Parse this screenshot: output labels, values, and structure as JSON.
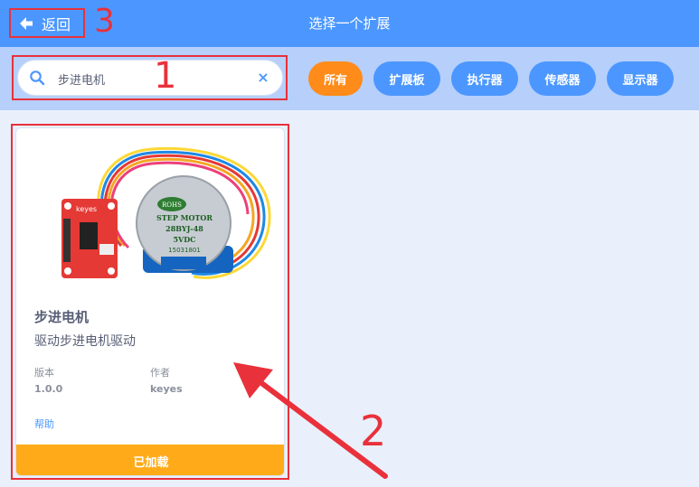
{
  "header": {
    "back_label": "返回",
    "title": "选择一个扩展",
    "back_icon": "arrow-left-icon"
  },
  "search": {
    "value": "步进电机",
    "search_icon": "search-icon",
    "clear_icon": "close-icon",
    "clear_symbol": "×"
  },
  "categories": [
    {
      "label": "所有",
      "active": true
    },
    {
      "label": "扩展板",
      "active": false
    },
    {
      "label": "执行器",
      "active": false
    },
    {
      "label": "传感器",
      "active": false
    },
    {
      "label": "显示器",
      "active": false
    }
  ],
  "extension_card": {
    "name": "步进电机",
    "description": "驱动步进电机驱动",
    "version_label": "版本",
    "version": "1.0.0",
    "author_label": "作者",
    "author": "keyes",
    "help_label": "帮助",
    "status_label": "已加载",
    "image_text": {
      "board_label": "keyes",
      "motor_badge": "ROHS",
      "motor_line1": "STEP MOTOR",
      "motor_line2": "28BYJ-48",
      "motor_line3": "5VDC",
      "motor_line4": "15031801"
    }
  },
  "annotations": {
    "n1": "1",
    "n2": "2",
    "n3": "3"
  },
  "colors": {
    "header": "#4c97ff",
    "filter_bar": "#b6cffb",
    "active_category": "#ff8c1a",
    "category": "#4c97ff",
    "loaded_button": "#ffab19",
    "annotation": "#e9313b",
    "background": "#e9f0fc"
  }
}
